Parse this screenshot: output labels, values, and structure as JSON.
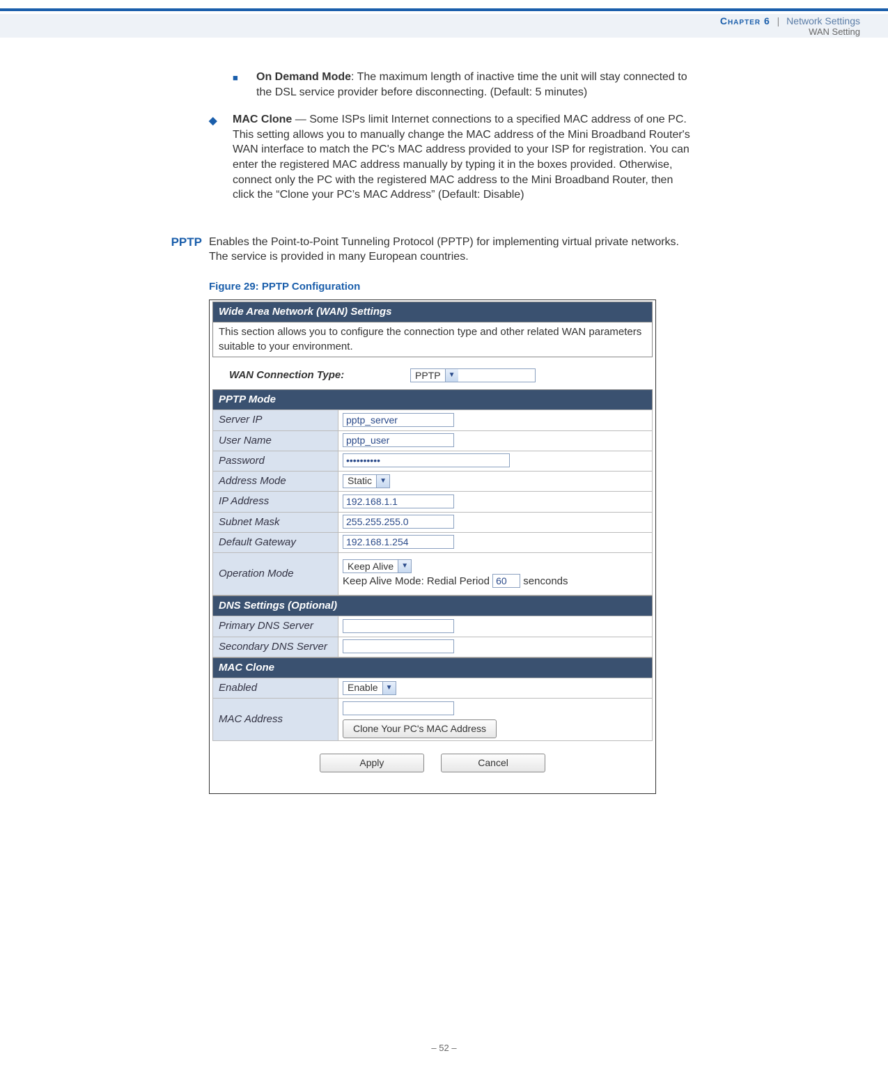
{
  "header": {
    "chapter_label": "Chapter 6",
    "separator": "|",
    "section": "Network Settings",
    "subsection": "WAN Setting"
  },
  "bullets": {
    "on_demand_title": "On Demand Mode",
    "on_demand_body": ": The maximum length of inactive time the unit will stay connected to the DSL service provider before disconnecting. (Default: 5 minutes)",
    "mac_clone_title": "MAC Clone",
    "mac_clone_body": " — Some ISPs limit Internet connections to a specified MAC address of one PC. This setting allows you to manually change the MAC address of the Mini Broadband Router's WAN interface to match the PC's MAC address provided to your ISP for registration. You can enter the registered MAC address manually by typing it in the boxes provided. Otherwise, connect only the PC with the registered MAC address to the Mini Broadband Router, then click the “Clone your PC’s MAC Address” (Default: Disable)"
  },
  "pptp": {
    "heading": "PPTP",
    "intro": "Enables the Point-to-Point Tunneling Protocol (PPTP) for implementing virtual private networks. The service is provided in many European countries.",
    "figure_caption": "Figure 29:  PPTP Configuration"
  },
  "panel": {
    "title": "Wide Area Network (WAN) Settings",
    "desc": "This section allows you to configure the connection type and other related WAN parameters suitable to your environment.",
    "conn_type_label": "WAN Connection Type:",
    "conn_type_value": "PPTP",
    "section_pptp": "PPTP Mode",
    "server_ip_label": "Server IP",
    "server_ip_value": "pptp_server",
    "user_name_label": "User Name",
    "user_name_value": "pptp_user",
    "password_label": "Password",
    "password_value": "••••••••••",
    "address_mode_label": "Address Mode",
    "address_mode_value": "Static",
    "ip_address_label": "IP Address",
    "ip_address_value": "192.168.1.1",
    "subnet_label": "Subnet Mask",
    "subnet_value": "255.255.255.0",
    "gateway_label": "Default Gateway",
    "gateway_value": "192.168.1.254",
    "op_mode_label": "Operation Mode",
    "op_mode_value": "Keep Alive",
    "op_mode_detail_pre": "Keep Alive Mode: Redial Period ",
    "op_mode_redial": "60",
    "op_mode_detail_post": " senconds",
    "section_dns": "DNS Settings (Optional)",
    "primary_dns_label": "Primary DNS Server",
    "primary_dns_value": "",
    "secondary_dns_label": "Secondary DNS Server",
    "secondary_dns_value": "",
    "section_mac": "MAC Clone",
    "enabled_label": "Enabled",
    "enabled_value": "Enable",
    "mac_addr_label": "MAC Address",
    "mac_addr_value": "",
    "clone_btn": "Clone Your PC's MAC Address",
    "apply_btn": "Apply",
    "cancel_btn": "Cancel"
  },
  "footer": {
    "page_number": "–  52  –"
  }
}
